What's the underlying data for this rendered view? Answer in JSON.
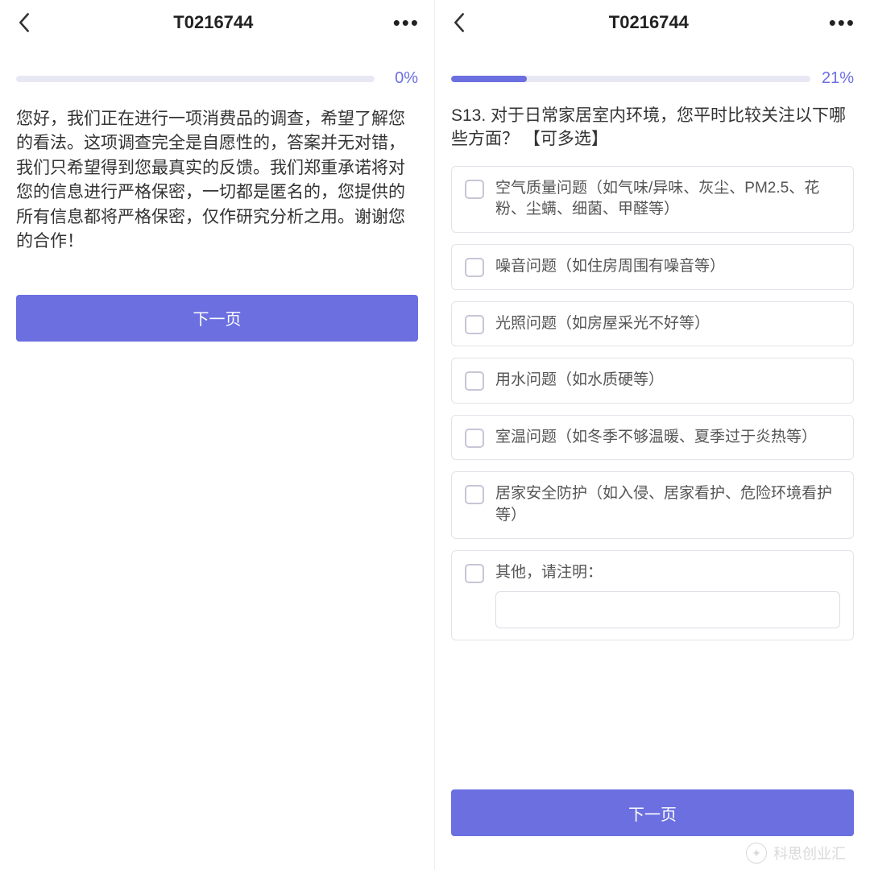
{
  "left": {
    "title": "T0216744",
    "progress_pct": "0%",
    "progress_fill": 0,
    "intro": "您好，我们正在进行一项消费品的调查，希望了解您的看法。这项调查完全是自愿性的，答案并无对错，我们只希望得到您最真实的反馈。我们郑重承诺将对您的信息进行严格保密，一切都是匿名的，您提供的所有信息都将严格保密，仅作研究分析之用。谢谢您的合作！",
    "next_label": "下一页"
  },
  "right": {
    "title": "T0216744",
    "progress_pct": "21%",
    "progress_fill": 21,
    "question": "S13. 对于日常家居室内环境，您平时比较关注以下哪些方面？ 【可多选】",
    "options": [
      "空气质量问题（如气味/异味、灰尘、PM2.5、花粉、尘螨、细菌、甲醛等）",
      "噪音问题（如住房周围有噪音等）",
      "光照问题（如房屋采光不好等）",
      "用水问题（如水质硬等）",
      "室温问题（如冬季不够温暖、夏季过于炎热等）",
      "居家安全防护（如入侵、居家看护、危险环境看护等）",
      "其他，请注明："
    ],
    "next_label": "下一页"
  },
  "watermark": "科思创业汇"
}
